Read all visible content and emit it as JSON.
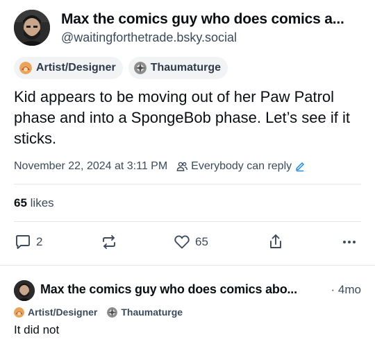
{
  "post": {
    "author_name": "Max the comics guy who does comics a...",
    "author_handle": "@waitingforthetrade.bsky.social",
    "badges": [
      {
        "label": "Artist/Designer",
        "icon": "artist-badge-icon"
      },
      {
        "label": "Thaumaturge",
        "icon": "thaumaturge-badge-icon"
      }
    ],
    "text": "Kid appears to be moving out of her Paw Patrol phase and into a SpongeBob phase. Let’s see if it sticks.",
    "timestamp": "November 22, 2024 at 3:11 PM",
    "reply_setting": "Everybody can reply",
    "likes_count": "65",
    "likes_label": "likes",
    "actions": {
      "reply_count": "2",
      "repost_count": "",
      "like_count": "65"
    }
  },
  "reply": {
    "author_name": "Max the comics guy who does comics abo...",
    "time": "· 4mo",
    "badges": [
      {
        "label": "Artist/Designer",
        "icon": "artist-badge-icon"
      },
      {
        "label": "Thaumaturge",
        "icon": "thaumaturge-badge-icon"
      }
    ],
    "text": "It did not"
  },
  "colors": {
    "accent": "#1083fe",
    "muted_text": "#3b4a5c",
    "divider": "#e4e8ec",
    "badge_bg": "#f1f3f5"
  }
}
